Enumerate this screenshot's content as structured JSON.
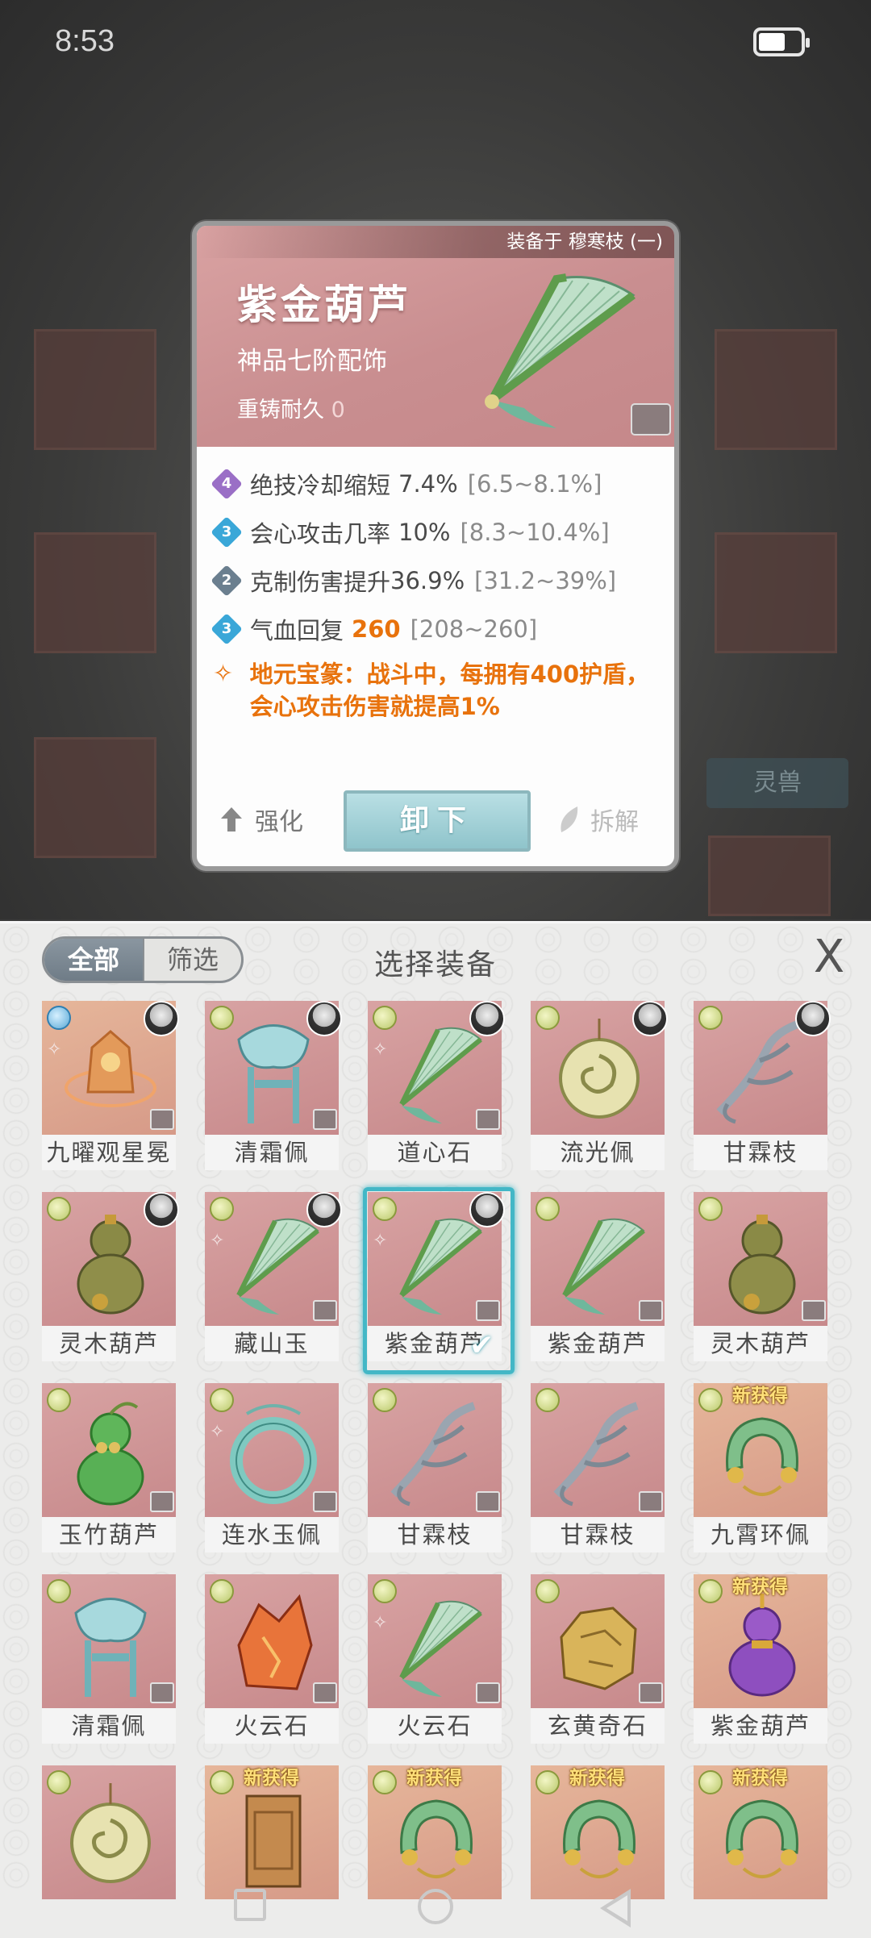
{
  "status_bar": {
    "time": "8:53",
    "battery_icon": "battery-icon"
  },
  "background": {
    "tag_label": "灵兽"
  },
  "detail": {
    "equipped_by": "装备于 穆寒枝 (一)",
    "name": "紫金葫芦",
    "grade": "神品七阶配饰",
    "reforge_label": "重铸耐久",
    "reforge_value": "0",
    "stats": [
      {
        "level": "4",
        "badge_color": "#9a6fc6",
        "label": "绝技冷却缩短",
        "value": "7.4%",
        "range": "[6.5~8.1%]",
        "value_highlight": false
      },
      {
        "level": "3",
        "badge_color": "#3aa7d8",
        "label": "会心攻击几率",
        "value": "10%",
        "range": "[8.3~10.4%]",
        "value_highlight": false
      },
      {
        "level": "2",
        "badge_color": "#6b7f8f",
        "label": "克制伤害提升",
        "value": "36.9%",
        "range": "[31.2~39%]",
        "value_highlight": false
      },
      {
        "level": "3",
        "badge_color": "#3aa7d8",
        "label": "气血回复",
        "value": "260",
        "range": "[208~260]",
        "value_highlight": true
      }
    ],
    "special_text": "地元宝篆：战斗中，每拥有400护盾，会心攻击伤害就提高1%",
    "upgrade_label": "强化",
    "unequip_label": "卸下",
    "dismantle_label": "拆解"
  },
  "panel": {
    "title": "选择装备",
    "tab_all": "全部",
    "tab_filter": "筛选",
    "close": "X",
    "new_tag": "新获得",
    "items": [
      {
        "name": "九曜观星冕",
        "art": "crown",
        "tier": "blue",
        "avatar": true,
        "set": true,
        "lock": true,
        "new": false,
        "bg": "gold"
      },
      {
        "name": "清霜佩",
        "art": "jade-knot",
        "tier": "green",
        "avatar": true,
        "set": false,
        "lock": true,
        "new": false,
        "bg": "pink"
      },
      {
        "name": "道心石",
        "art": "fan",
        "tier": "green",
        "avatar": true,
        "set": true,
        "lock": true,
        "new": false,
        "bg": "pink"
      },
      {
        "name": "流光佩",
        "art": "disc",
        "tier": "green",
        "avatar": true,
        "set": false,
        "lock": false,
        "new": false,
        "bg": "pink"
      },
      {
        "name": "甘霖枝",
        "art": "branch",
        "tier": "green",
        "avatar": true,
        "set": false,
        "lock": false,
        "new": false,
        "bg": "pink"
      },
      {
        "name": "灵木葫芦",
        "art": "gourd-olive",
        "tier": "green",
        "avatar": true,
        "set": false,
        "lock": false,
        "new": false,
        "bg": "pink"
      },
      {
        "name": "藏山玉",
        "art": "fan",
        "tier": "green",
        "avatar": true,
        "set": true,
        "lock": true,
        "new": false,
        "bg": "pink"
      },
      {
        "name": "紫金葫芦",
        "art": "fan",
        "tier": "green",
        "avatar": true,
        "set": true,
        "lock": true,
        "new": false,
        "bg": "pink",
        "selected": true
      },
      {
        "name": "紫金葫芦",
        "art": "fan",
        "tier": "green",
        "avatar": false,
        "set": false,
        "lock": true,
        "new": false,
        "bg": "pink"
      },
      {
        "name": "灵木葫芦",
        "art": "gourd-olive",
        "tier": "green",
        "avatar": false,
        "set": false,
        "lock": true,
        "new": false,
        "bg": "pink"
      },
      {
        "name": "玉竹葫芦",
        "art": "gourd-green",
        "tier": "green",
        "avatar": false,
        "set": false,
        "lock": true,
        "new": false,
        "bg": "pink"
      },
      {
        "name": "连水玉佩",
        "art": "jade-ring",
        "tier": "green",
        "avatar": false,
        "set": true,
        "lock": true,
        "new": false,
        "bg": "pink"
      },
      {
        "name": "甘霖枝",
        "art": "branch",
        "tier": "green",
        "avatar": false,
        "set": false,
        "lock": true,
        "new": false,
        "bg": "pink"
      },
      {
        "name": "甘霖枝",
        "art": "branch",
        "tier": "green",
        "avatar": false,
        "set": false,
        "lock": true,
        "new": false,
        "bg": "pink"
      },
      {
        "name": "九霄环佩",
        "art": "horseshoe",
        "tier": "green",
        "avatar": false,
        "set": false,
        "lock": false,
        "new": true,
        "bg": "gold"
      },
      {
        "name": "清霜佩",
        "art": "jade-knot",
        "tier": "green",
        "avatar": false,
        "set": false,
        "lock": true,
        "new": false,
        "bg": "pink"
      },
      {
        "name": "火云石",
        "art": "flame-rock",
        "tier": "green",
        "avatar": false,
        "set": false,
        "lock": true,
        "new": false,
        "bg": "pink"
      },
      {
        "name": "火云石",
        "art": "fan",
        "tier": "green",
        "avatar": false,
        "set": true,
        "lock": true,
        "new": false,
        "bg": "pink"
      },
      {
        "name": "玄黄奇石",
        "art": "gold-rock",
        "tier": "green",
        "avatar": false,
        "set": false,
        "lock": true,
        "new": false,
        "bg": "pink"
      },
      {
        "name": "紫金葫芦",
        "art": "gourd-purple",
        "tier": "green",
        "avatar": false,
        "set": false,
        "lock": false,
        "new": true,
        "bg": "gold"
      },
      {
        "name": "",
        "art": "disc",
        "tier": "green",
        "avatar": false,
        "set": false,
        "lock": false,
        "new": false,
        "bg": "pink"
      },
      {
        "name": "",
        "art": "seal",
        "tier": "green",
        "avatar": false,
        "set": false,
        "lock": false,
        "new": true,
        "bg": "gold"
      },
      {
        "name": "",
        "art": "horseshoe",
        "tier": "green",
        "avatar": false,
        "set": false,
        "lock": false,
        "new": true,
        "bg": "gold"
      },
      {
        "name": "",
        "art": "horseshoe",
        "tier": "green",
        "avatar": false,
        "set": false,
        "lock": false,
        "new": true,
        "bg": "gold"
      },
      {
        "name": "",
        "art": "horseshoe",
        "tier": "green",
        "avatar": false,
        "set": false,
        "lock": false,
        "new": true,
        "bg": "gold"
      }
    ]
  }
}
